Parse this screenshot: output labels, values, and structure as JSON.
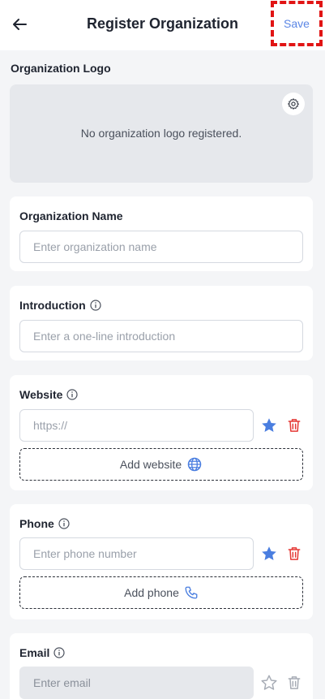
{
  "header": {
    "title": "Register Organization",
    "save_label": "Save"
  },
  "logo": {
    "section_label": "Organization Logo",
    "empty_text": "No organization logo registered."
  },
  "org_name": {
    "label": "Organization Name",
    "placeholder": "Enter organization name"
  },
  "introduction": {
    "label": "Introduction",
    "placeholder": "Enter a one-line introduction"
  },
  "website": {
    "label": "Website",
    "placeholder": "https://",
    "add_label": "Add website"
  },
  "phone": {
    "label": "Phone",
    "placeholder": "Enter phone number",
    "add_label": "Add phone"
  },
  "email": {
    "label": "Email",
    "placeholder": "Enter email"
  },
  "colors": {
    "accent": "#5b86e5",
    "delete": "#e53935",
    "star_active": "#4a7ee0",
    "star_inactive": "#a7acb5"
  }
}
